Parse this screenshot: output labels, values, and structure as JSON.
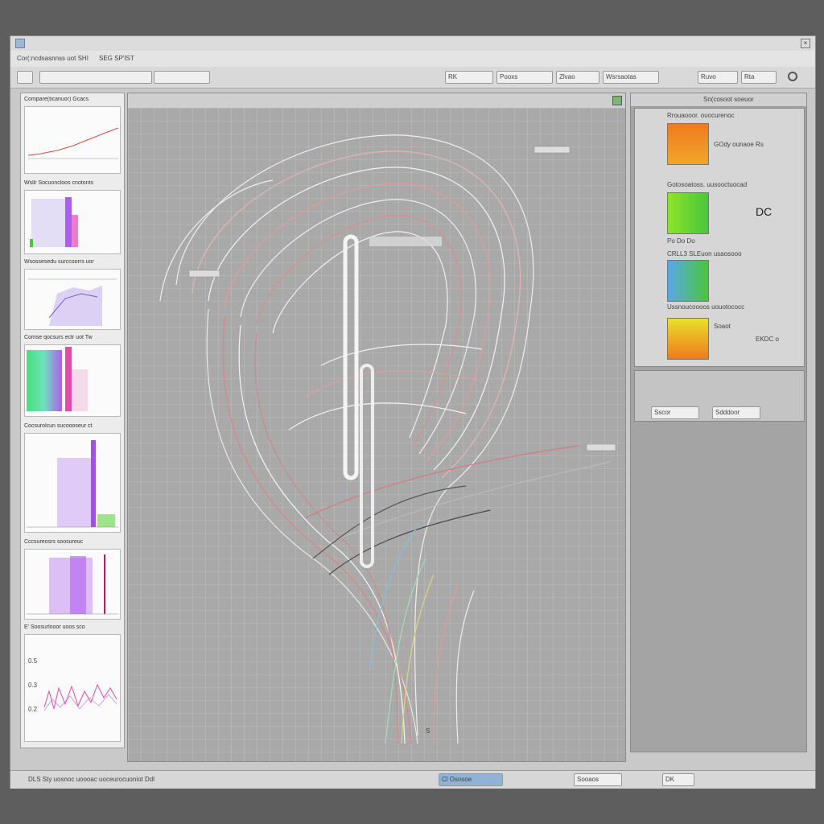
{
  "window": {
    "title_label": "",
    "menu": {
      "left_text": "Cor(:ncdsasnnss uot SHI",
      "left_text2": "SEG SP'IST"
    },
    "toolbar": {
      "right_buttons": [
        "RK",
        "Pooxs",
        "Zlvao",
        "Wsrsaotas",
        "Ruvo",
        "Rta"
      ]
    }
  },
  "thumbnails": {
    "items": [
      {
        "caption": "Compare(ticanuor)  Gcacs"
      },
      {
        "caption": "Wsllr Socuoncloos cnotonts"
      },
      {
        "caption": "Wsossesedu surccoorrs uor"
      },
      {
        "caption": "Comse qocsurs ectr uot Tw"
      },
      {
        "caption": "Cocsurolcun sucoooseur ct"
      },
      {
        "caption": "Cccsureosrs soosureuc"
      },
      {
        "caption": "E' Soosurlooor uoos sco"
      }
    ],
    "last_axis_labels": [
      "0.5",
      "0.3",
      "0.2"
    ]
  },
  "canvas": {
    "header_label": "",
    "callouts": [
      "",
      "",
      ""
    ],
    "axis_note": "S"
  },
  "right_panel": {
    "header": "Sn(cosoot soeuor",
    "rows": [
      {
        "title": "Rrouaooor. ouocurenoc",
        "sub": "GOdy  ounaoe  Rs",
        "note": ""
      },
      {
        "title": "Gotosoatoss. uusooctuocad",
        "sub": "Po  Do  Do",
        "note": "DC"
      },
      {
        "title": "CRLL3  SLEuon usaosooo",
        "sub": "",
        "note": ""
      },
      {
        "title": "Ussnoucoooos uouotococc",
        "sub": "Soaot",
        "note": "EKDC o"
      }
    ],
    "lower_tabs": [
      "Sscor",
      "Sdddoor"
    ]
  },
  "status": {
    "left": "DLS Sty  uosnoc uoooac uoceurocuoniot  Ddl",
    "center": "Cl  Ososoe",
    "right_items": [
      "Sooaos",
      "DK"
    ]
  },
  "colors": {
    "window_bg": "#c9c9c9",
    "desktop": "#5e5e5e",
    "canvas_bg": "#a9a9a9",
    "accent_orange": "#f07a1e",
    "accent_green": "#49c73a",
    "accent_purple": "#b05cf0",
    "accent_pink": "#e64aa8",
    "accent_blue": "#5aa7e8"
  },
  "icons": [
    "window-icon",
    "toolbar-icon",
    "search-icon",
    "close-icon"
  ]
}
